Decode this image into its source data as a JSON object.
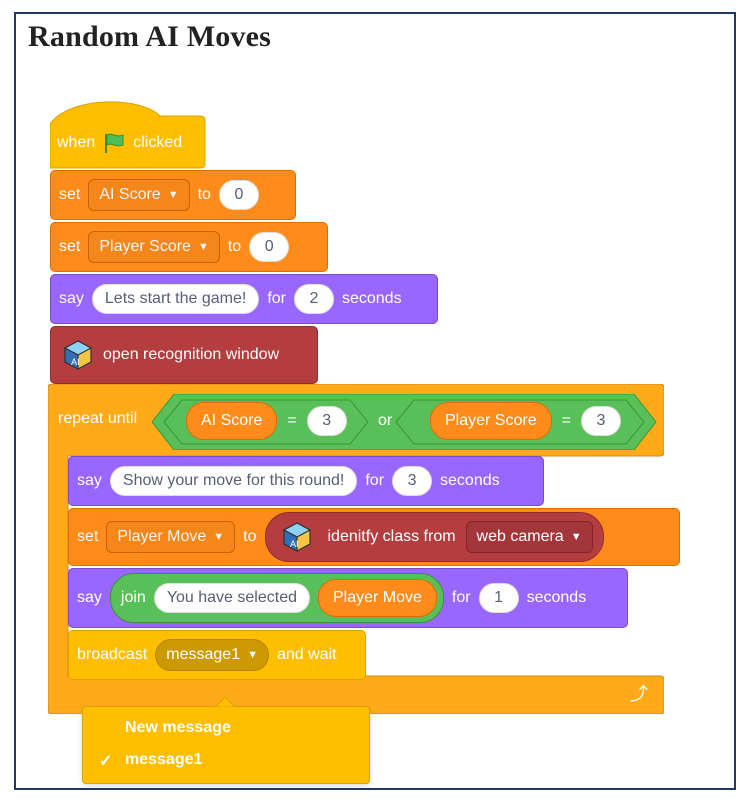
{
  "title": "Random AI Moves",
  "blocks": {
    "hat": {
      "when": "when",
      "clicked": "clicked"
    },
    "set1": {
      "set": "set",
      "var": "AI Score",
      "to": "to",
      "value": "0"
    },
    "set2": {
      "set": "set",
      "var": "Player Score",
      "to": "to",
      "value": "0"
    },
    "say1": {
      "say": "say",
      "text": "Lets start the game!",
      "for": "for",
      "secs": "2",
      "seconds": "seconds"
    },
    "ml_open": {
      "label": "open recognition window"
    },
    "repeat": {
      "label": "repeat until",
      "left": {
        "reporter": "AI Score",
        "op": "=",
        "value": "3"
      },
      "or": "or",
      "right": {
        "reporter": "Player Score",
        "op": "=",
        "value": "3"
      }
    },
    "say2": {
      "say": "say",
      "text": "Show your move for this round!",
      "for": "for",
      "secs": "3",
      "seconds": "seconds"
    },
    "set3": {
      "set": "set",
      "var": "Player Move",
      "to": "to",
      "classify": "idenitfy class from",
      "source": "web camera"
    },
    "say3": {
      "say": "say",
      "join": "join",
      "text": "You have selected",
      "reporter": "Player Move",
      "for": "for",
      "secs": "1",
      "seconds": "seconds"
    },
    "broadcast": {
      "label": "broadcast",
      "message": "message1",
      "wait": "and wait"
    }
  },
  "dropdown_menu": {
    "items": [
      "New message",
      "message1"
    ],
    "selected": "message1",
    "check": "✓"
  },
  "colors": {
    "events": "#ffbf00",
    "variables": "#ff8c1a",
    "looks": "#9966ff",
    "ml": "#b33d3f",
    "control": "#ffab19",
    "operators": "#59c059"
  }
}
